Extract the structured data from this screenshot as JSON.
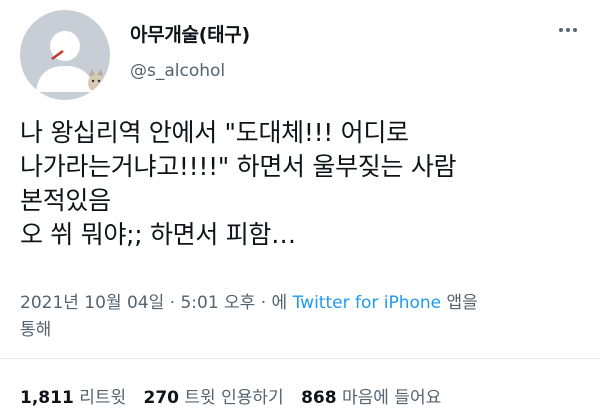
{
  "user": {
    "display_name": "아무개술(태구)",
    "handle": "@s_alcohol",
    "avatar_icon": "default-avatar-with-cat-icon"
  },
  "more_icon": "more-options-icon",
  "tweet": {
    "lines": [
      "나 왕십리역 안에서 \"도대체!!! 어디로",
      "나가라는거냐고!!!!\" 하면서 울부짖는 사람",
      "본적있음",
      "오 쒸 뭐야;; 하면서 피함…"
    ]
  },
  "meta": {
    "timestamp": "2021년 10월 04일 · 5:01 오후 · 에 ",
    "app": "Twitter for iPhone",
    "suffix_1": " 앱을",
    "suffix_2": "통해"
  },
  "stats": {
    "retweets_count": "1,811",
    "retweets_label": "리트윗",
    "quotes_count": "270",
    "quotes_label": "트윗 인용하기",
    "likes_count": "868",
    "likes_label": "마음에 들어요"
  },
  "colors": {
    "link": "#1d9bf0",
    "secondary_text": "#536471",
    "avatar_bg": "#c8ced6"
  }
}
